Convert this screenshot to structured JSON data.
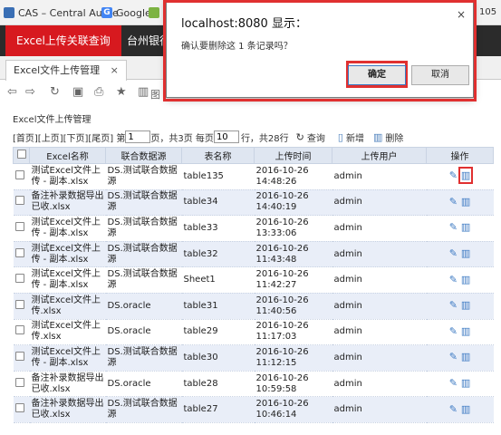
{
  "bookmarks": {
    "item1": "CAS – Central Authe",
    "item2": "Google",
    "edge_text": "105"
  },
  "topnav": {
    "active": "Excel上传关联查询",
    "second": "台州银行"
  },
  "tabbar": {
    "tab_label": "Excel文件上传管理",
    "tab_close": "×"
  },
  "toolbar": {
    "back_icon": "⇦",
    "forward_icon": "⇨",
    "refresh_icon": "↻",
    "save_icon": "▣",
    "print_icon": "⎙",
    "star_icon": "★",
    "chart_icon": "▥",
    "chart_label": "图"
  },
  "page": {
    "title": "Excel文件上传管理"
  },
  "pager": {
    "nav": "[首页][上页][下页][尾页] 第",
    "page_value": "1",
    "page_suffix": "页，共3页 每页",
    "per_page_value": "10",
    "total": "行，共28行",
    "query": "查询",
    "add": "新增",
    "delete": "删除"
  },
  "table": {
    "headers": [
      "",
      "Excel名称",
      "联合数据源",
      "表名称",
      "上传时间",
      "上传用户",
      "操作"
    ],
    "rows": [
      {
        "name": "测试Excel文件上传 - 副本.xlsx",
        "ds": "DS.测试联合数据源",
        "table": "table135",
        "time": "2016-10-26 14:48:26",
        "user": "admin"
      },
      {
        "name": "备注补录数据导出已收.xlsx",
        "ds": "DS.测试联合数据源",
        "table": "table34",
        "time": "2016-10-26 14:40:19",
        "user": "admin"
      },
      {
        "name": "测试Excel文件上传 - 副本.xlsx",
        "ds": "DS.测试联合数据源",
        "table": "table33",
        "time": "2016-10-26 13:33:06",
        "user": "admin"
      },
      {
        "name": "测试Excel文件上传 - 副本.xlsx",
        "ds": "DS.测试联合数据源",
        "table": "table32",
        "time": "2016-10-26 11:43:48",
        "user": "admin"
      },
      {
        "name": "测试Excel文件上传 - 副本.xlsx",
        "ds": "DS.测试联合数据源",
        "table": "Sheet1",
        "time": "2016-10-26 11:42:27",
        "user": "admin"
      },
      {
        "name": "测试Excel文件上传.xlsx",
        "ds": "DS.oracle",
        "table": "table31",
        "time": "2016-10-26 11:40:56",
        "user": "admin"
      },
      {
        "name": "测试Excel文件上传.xlsx",
        "ds": "DS.oracle",
        "table": "table29",
        "time": "2016-10-26 11:17:03",
        "user": "admin"
      },
      {
        "name": "测试Excel文件上传 - 副本.xlsx",
        "ds": "DS.测试联合数据源",
        "table": "table30",
        "time": "2016-10-26 11:12:15",
        "user": "admin"
      },
      {
        "name": "备注补录数据导出已收.xlsx",
        "ds": "DS.oracle",
        "table": "table28",
        "time": "2016-10-26 10:59:58",
        "user": "admin"
      },
      {
        "name": "备注补录数据导出已收.xlsx",
        "ds": "DS.测试联合数据源",
        "table": "table27",
        "time": "2016-10-26 10:46:14",
        "user": "admin"
      }
    ]
  },
  "dialog": {
    "title": "localhost:8080 显示：",
    "close": "×",
    "message": "确认要删除这 1 条记录吗？",
    "ok": "确定",
    "cancel": "取消"
  },
  "colors": {
    "nav_bg": "#2b2b2b",
    "nav_active": "#d7191f",
    "header_bg": "#dfe6f1",
    "alt_row": "#e9eef8",
    "highlight": "#e03030"
  }
}
